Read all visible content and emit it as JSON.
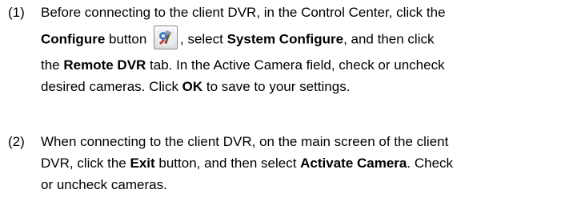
{
  "items": [
    {
      "number": "(1)",
      "lines": [
        [
          "Before connecting to the client DVR, in the Control Center, click the"
        ],
        [
          "Configure",
          " button ",
          "",
          ", select ",
          "System Configure",
          ", and then click"
        ],
        [
          "the ",
          "Remote DVR",
          " tab. In the Active Camera field, check or uncheck"
        ],
        [
          "desired cameras. Click ",
          "OK",
          " to save to your settings."
        ]
      ],
      "icon": "configure-tools-icon"
    },
    {
      "number": "(2)",
      "lines": [
        [
          "When connecting to the client DVR, on the main screen of the client"
        ],
        [
          "DVR, click the ",
          "Exit",
          " button, and then select ",
          "Activate Camera",
          ". Check"
        ],
        [
          "or uncheck cameras."
        ]
      ]
    }
  ]
}
